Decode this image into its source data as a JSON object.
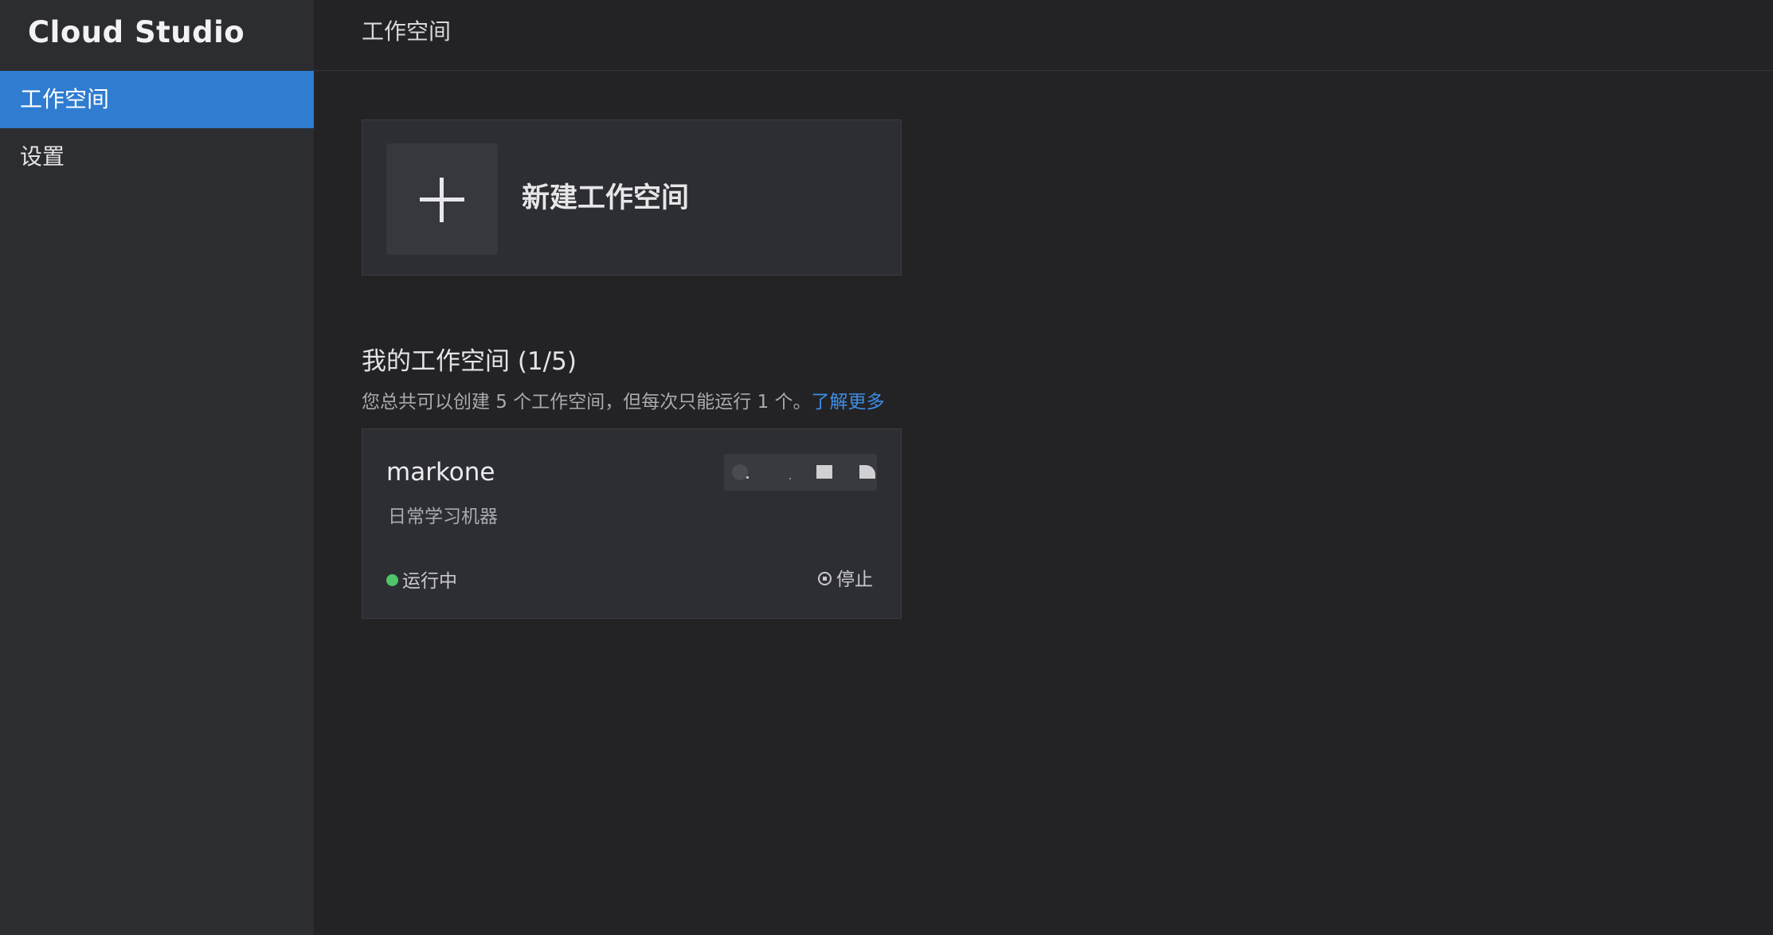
{
  "app": {
    "brand": "Cloud Studio"
  },
  "sidebar": {
    "items": [
      {
        "label": "工作空间",
        "active": true
      },
      {
        "label": "设置",
        "active": false
      }
    ]
  },
  "header": {
    "title": "工作空间"
  },
  "new_workspace": {
    "label": "新建工作空间"
  },
  "workspaces": {
    "title": "我的工作空间 (1/5)",
    "description": "您总共可以创建 5 个工作空间，但每次只能运行 1 个。",
    "learn_more": "了解更多",
    "items": [
      {
        "name": "markone",
        "description": "日常学习机器",
        "status": "运行中",
        "stop_label": "停止"
      }
    ]
  },
  "colors": {
    "accent": "#2f7cd1",
    "link": "#3d8de6",
    "running": "#4fc46a"
  }
}
